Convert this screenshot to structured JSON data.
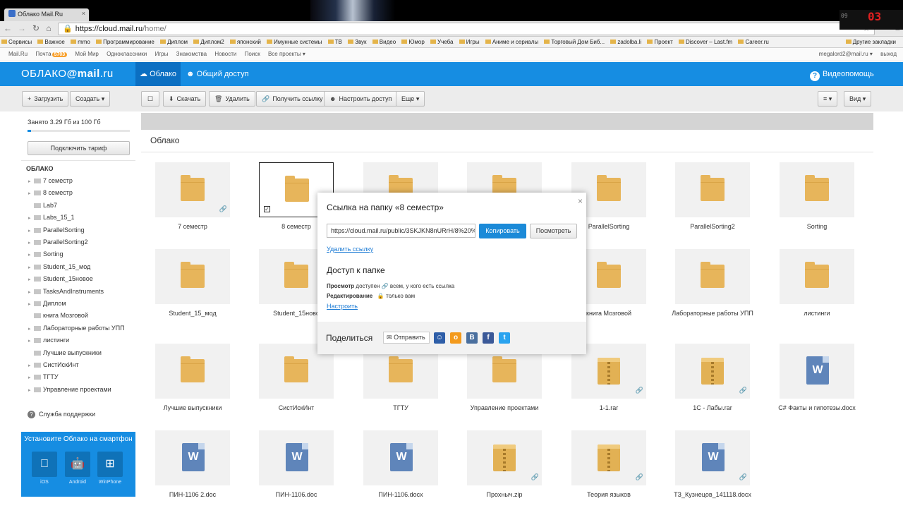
{
  "browser": {
    "tab_title": "Облако Mail.Ru",
    "tab_close": "×",
    "url_host": "https://cloud.mail.ru",
    "url_path": "/home/",
    "tray_small": "09",
    "tray_time": "03",
    "bookmarks": [
      "Сервисы",
      "Важное",
      "mmo",
      "Программирование",
      "Диплом",
      "Диплом2",
      "японский",
      "Имунные системы",
      "ТВ",
      "Звук",
      "Видео",
      "Юмор",
      "Учеба",
      "Игры",
      "Аниме и сериалы",
      "Торговый Дом Биб...",
      "zadolba.li",
      "Проект",
      "Discover – Last.fm",
      "Career.ru"
    ],
    "bookmarks_other": "Другие закладки"
  },
  "mailru_bar": {
    "items": [
      "Mail.Ru",
      "Почта",
      "Мой Мир",
      "Одноклассники",
      "Игры",
      "Знакомства",
      "Новости",
      "Поиск",
      "Все проекты ▾"
    ],
    "mail_badge": "5703",
    "user": "megalord2@mail.ru ▾",
    "logout": "выход"
  },
  "header": {
    "logo_a": "ОБЛАКО",
    "logo_b": "@mail",
    "logo_c": ".ru",
    "cloud_tab": "Облако",
    "share_tab": "Общий доступ",
    "help": "Видеопомощь"
  },
  "toolbar": {
    "upload": "Загрузить",
    "create": "Создать ▾",
    "download": "Скачать",
    "delete": "Удалить",
    "get_link": "Получить ссылку",
    "access": "Настроить доступ",
    "more": "Еще ▾",
    "view": "Вид ▾"
  },
  "sidebar": {
    "quota_text": "Занято 3.29 Гб из 100 Гб",
    "quota_fraction": 0.033,
    "tariff_button": "Подключить тариф",
    "tree_header": "ОБЛАКО",
    "tree": [
      {
        "label": "7 семестр",
        "arrow": true
      },
      {
        "label": "8 семестр",
        "arrow": true
      },
      {
        "label": "Lab7",
        "arrow": false
      },
      {
        "label": "Labs_15_1",
        "arrow": true
      },
      {
        "label": "ParallelSorting",
        "arrow": true
      },
      {
        "label": "ParallelSorting2",
        "arrow": true
      },
      {
        "label": "Sorting",
        "arrow": true
      },
      {
        "label": "Student_15_мод",
        "arrow": true
      },
      {
        "label": "Student_15новое",
        "arrow": true
      },
      {
        "label": "TasksAndInstruments",
        "arrow": true
      },
      {
        "label": "Диплом",
        "arrow": true
      },
      {
        "label": "книга Мозговой",
        "arrow": false
      },
      {
        "label": "Лабораторные работы УПП",
        "arrow": true
      },
      {
        "label": "листинги",
        "arrow": true
      },
      {
        "label": "Лучшие выпускники",
        "arrow": false
      },
      {
        "label": "СистИскИнт",
        "arrow": true
      },
      {
        "label": "ТГТУ",
        "arrow": true
      },
      {
        "label": "Управление проектами",
        "arrow": true
      }
    ],
    "support": "Служба поддержки",
    "promo_title": "Установите Облако на смартфон",
    "platforms": [
      "iOS",
      "Android",
      "WinPhone"
    ]
  },
  "main": {
    "crumb": "Облако",
    "files": [
      {
        "name": "7 семестр",
        "type": "folder",
        "link": true
      },
      {
        "name": "8 семестр",
        "type": "folder",
        "selected": true
      },
      {
        "name": "",
        "type": "folder"
      },
      {
        "name": "",
        "type": "folder"
      },
      {
        "name": "ParallelSorting",
        "type": "folder"
      },
      {
        "name": "ParallelSorting2",
        "type": "folder"
      },
      {
        "name": "Sorting",
        "type": "folder"
      },
      {
        "name": "Student_15_мод",
        "type": "folder"
      },
      {
        "name": "Student_15ново",
        "type": "folder"
      },
      {
        "name": "",
        "type": "folder"
      },
      {
        "name": "",
        "type": "folder"
      },
      {
        "name": "книга Мозговой",
        "type": "folder"
      },
      {
        "name": "Лабораторные работы УПП",
        "type": "folder"
      },
      {
        "name": "листинги",
        "type": "folder"
      },
      {
        "name": "Лучшие выпускники",
        "type": "folder"
      },
      {
        "name": "СистИскИнт",
        "type": "folder"
      },
      {
        "name": "ТГТУ",
        "type": "folder"
      },
      {
        "name": "Управление проектами",
        "type": "folder"
      },
      {
        "name": "1-1.rar",
        "type": "zip",
        "link": true
      },
      {
        "name": "1С - Лабы.rar",
        "type": "zip",
        "link": true
      },
      {
        "name": "C# Факты и гипотезы.docx",
        "type": "word"
      },
      {
        "name": "ПИН-1106 2.doc",
        "type": "word"
      },
      {
        "name": "ПИН-1106.doc",
        "type": "word"
      },
      {
        "name": "ПИН-1106.docx",
        "type": "word"
      },
      {
        "name": "Прохныч.zip",
        "type": "zip",
        "link": true
      },
      {
        "name": "Теория языков",
        "type": "zip",
        "link": true
      },
      {
        "name": "ТЗ_Кузнецов_141118.docx",
        "type": "word",
        "link": true
      }
    ]
  },
  "modal": {
    "title": "Ссылка на папку «8 семестр»",
    "url": "https://cloud.mail.ru/public/3SKJKN8nURrH/8%20%",
    "copy": "Копировать",
    "view": "Посмотреть",
    "delete_link": "Удалить ссылку",
    "access_title": "Доступ к папке",
    "view_label": "Просмотр",
    "view_value": "доступен",
    "view_who": "всем, у кого есть ссылка",
    "edit_label": "Редактирование",
    "edit_who": "только вам",
    "configure": "Настроить",
    "share_title": "Поделиться",
    "send": "Отправить",
    "social": [
      "my",
      "ok",
      "vk",
      "fb",
      "tw"
    ]
  }
}
